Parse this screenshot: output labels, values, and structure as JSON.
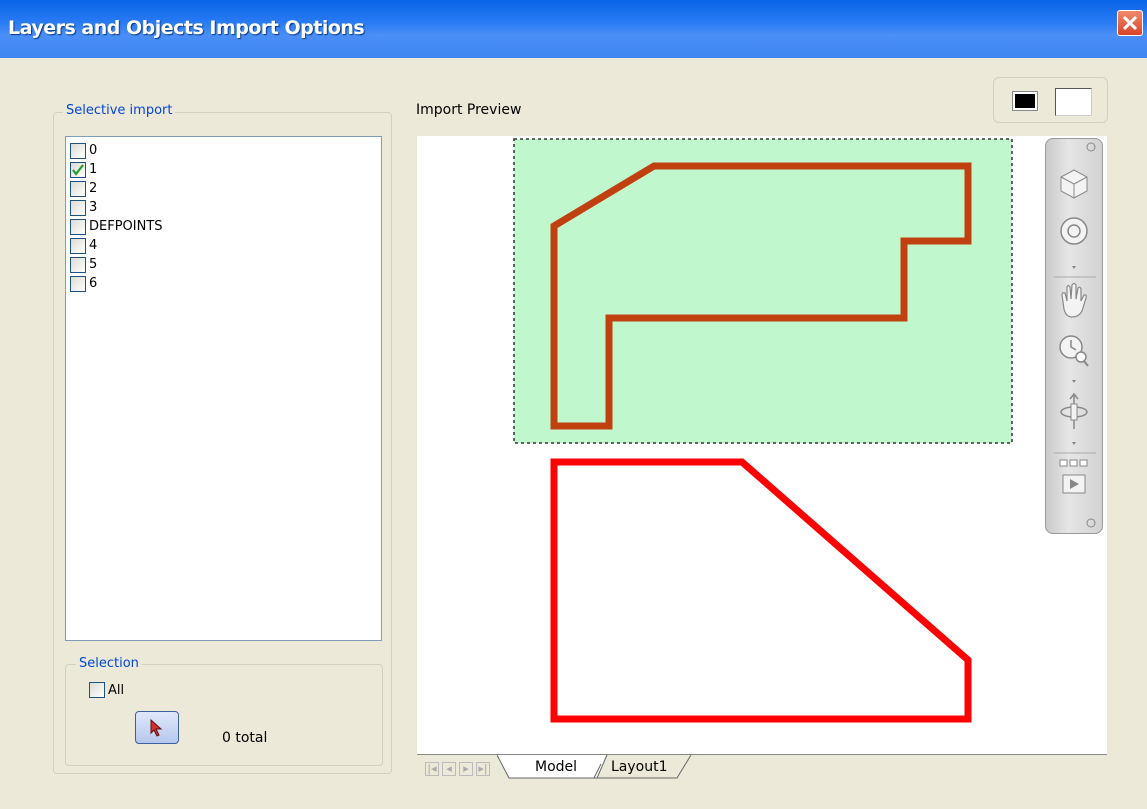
{
  "window": {
    "title": "Layers and Objects Import Options"
  },
  "selective_import": {
    "legend": "Selective import",
    "layers": [
      {
        "name": "0",
        "checked": false
      },
      {
        "name": "1",
        "checked": true
      },
      {
        "name": "2",
        "checked": false
      },
      {
        "name": "3",
        "checked": false
      },
      {
        "name": "DEFPOINTS",
        "checked": false
      },
      {
        "name": "4",
        "checked": false
      },
      {
        "name": "5",
        "checked": false
      },
      {
        "name": "6",
        "checked": false
      }
    ]
  },
  "selection": {
    "legend": "Selection",
    "all_label": "All",
    "all_checked": false,
    "total_text": "0 total"
  },
  "preview": {
    "label": "Import Preview",
    "background_options": [
      "black",
      "white"
    ],
    "colors": {
      "highlight_fill": "#c0f7cc",
      "selected_outline": "#c04010",
      "shape_outline": "#ff0000"
    }
  },
  "navigation_bar": {
    "tools": [
      "view-cube-icon",
      "steering-wheel-icon",
      "pan-icon",
      "zoom-icon",
      "orbit-icon",
      "showmotion-icon"
    ]
  },
  "tabs": {
    "items": [
      "Model",
      "Layout1"
    ],
    "active": "Model"
  }
}
